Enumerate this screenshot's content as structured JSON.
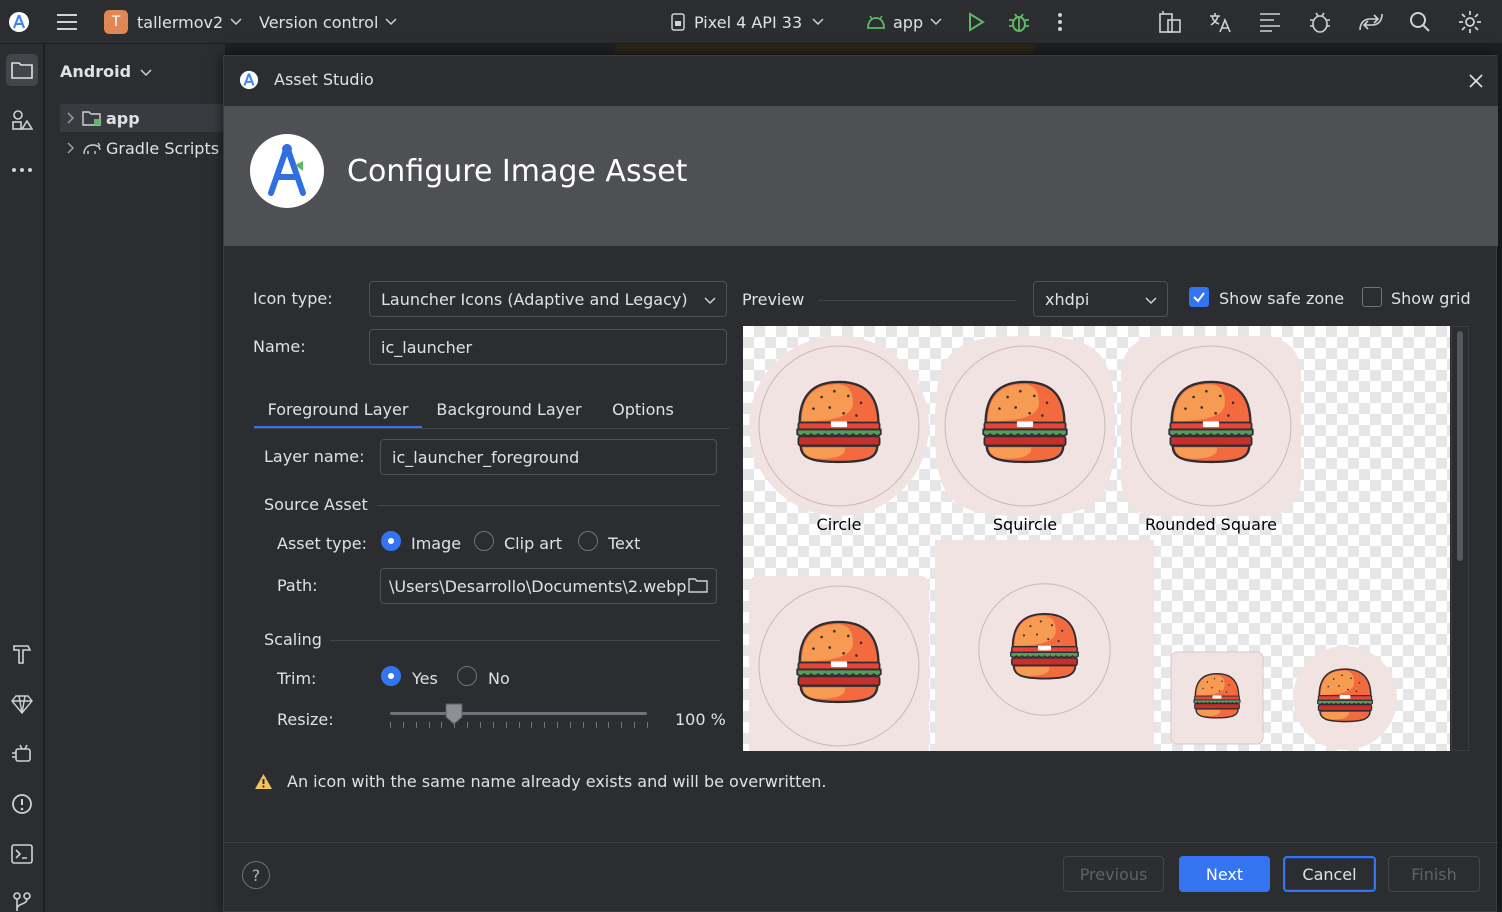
{
  "toolbar": {
    "project_initial": "T",
    "project_name": "tallermov2",
    "vcs_label": "Version control",
    "device_label": "Pixel 4 API 33",
    "run_config_label": "app"
  },
  "project_panel": {
    "view_label": "Android",
    "items": [
      {
        "label": "app"
      },
      {
        "label": "Gradle Scripts"
      }
    ]
  },
  "dialog": {
    "title": "Asset Studio",
    "header_title": "Configure Image Asset",
    "icon_type_label": "Icon type:",
    "icon_type_value": "Launcher Icons (Adaptive and Legacy)",
    "name_label": "Name:",
    "name_value": "ic_launcher",
    "tabs": [
      {
        "label": "Foreground Layer",
        "active": true
      },
      {
        "label": "Background Layer",
        "active": false
      },
      {
        "label": "Options",
        "active": false
      }
    ],
    "layer_name_label": "Layer name:",
    "layer_name_value": "ic_launcher_foreground",
    "source_asset_label": "Source Asset",
    "asset_type_label": "Asset type:",
    "asset_type_options": [
      {
        "label": "Image",
        "selected": true
      },
      {
        "label": "Clip art",
        "selected": false
      },
      {
        "label": "Text",
        "selected": false
      }
    ],
    "path_label": "Path:",
    "path_value": "\\Users\\Desarrollo\\Documents\\2.webp",
    "scaling_label": "Scaling",
    "trim_label": "Trim:",
    "trim_options": [
      {
        "label": "Yes",
        "selected": true
      },
      {
        "label": "No",
        "selected": false
      }
    ],
    "resize_label": "Resize:",
    "resize_value": "100 %",
    "resize_fraction": 0.25,
    "preview_label": "Preview",
    "density_value": "xhdpi",
    "show_safe_zone_label": "Show safe zone",
    "show_safe_zone_checked": true,
    "show_grid_label": "Show grid",
    "show_grid_checked": false,
    "preview_captions": [
      "Circle",
      "Squircle",
      "Rounded Square"
    ],
    "warning_text": "An icon with the same name already exists and will be overwritten.",
    "buttons": {
      "help": "?",
      "previous": "Previous",
      "next": "Next",
      "cancel": "Cancel",
      "finish": "Finish"
    }
  },
  "colors": {
    "accent": "#3574f0",
    "header_bg": "#4e5054",
    "warning": "#f2c55c"
  }
}
